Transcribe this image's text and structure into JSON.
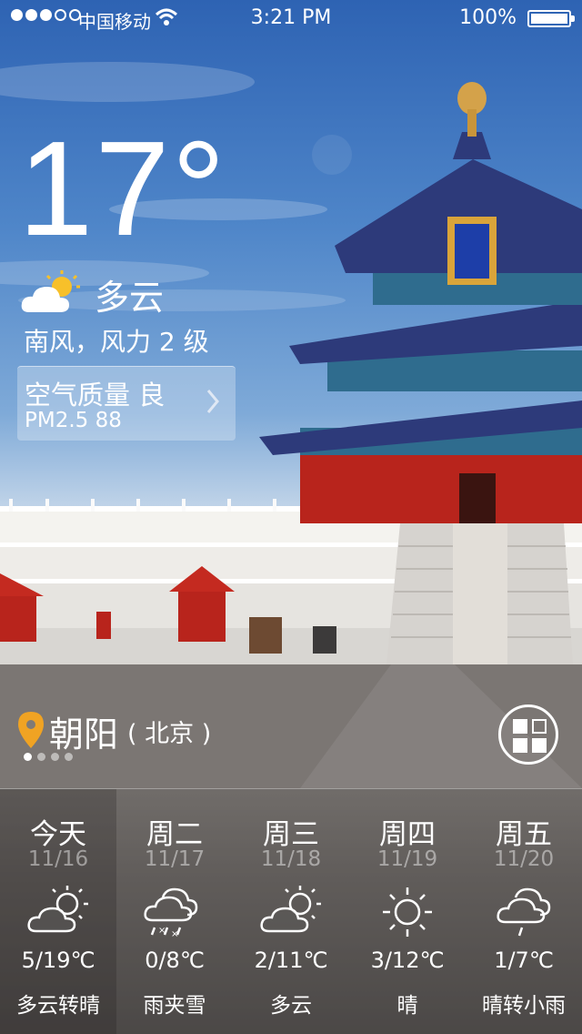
{
  "status_bar": {
    "carrier": "中国移动",
    "time": "3:21 PM",
    "battery": "100%",
    "signal_bars_on": 3,
    "signal_bars_total": 5
  },
  "current": {
    "temperature": "17°",
    "condition": "多云",
    "condition_icon": "partly-cloudy-icon",
    "wind": "南风，风力 2 级"
  },
  "air_quality": {
    "title": "空气质量  良",
    "pm": "PM2.5  88"
  },
  "location": {
    "name": "朝阳",
    "sub": "( 北京 )",
    "page_count": 4,
    "active_page": 1
  },
  "forecast": [
    {
      "name": "今天",
      "date": "11/16",
      "range": "5/19℃",
      "desc": "多云转晴",
      "icon": "partly-cloudy-icon"
    },
    {
      "name": "周二",
      "date": "11/17",
      "range": "0/8℃",
      "desc": "雨夹雪",
      "icon": "sleet-icon"
    },
    {
      "name": "周三",
      "date": "11/18",
      "range": "2/11℃",
      "desc": "多云",
      "icon": "partly-cloudy-icon"
    },
    {
      "name": "周四",
      "date": "11/19",
      "range": "3/12℃",
      "desc": "晴",
      "icon": "sunny-icon"
    },
    {
      "name": "周五",
      "date": "11/20",
      "range": "1/7℃",
      "desc": "晴转小雨",
      "icon": "light-rain-icon"
    }
  ],
  "colors": {
    "location_pin": "#f0a323",
    "temple_roof": "#2d3a7a",
    "temple_red": "#b8241c"
  }
}
